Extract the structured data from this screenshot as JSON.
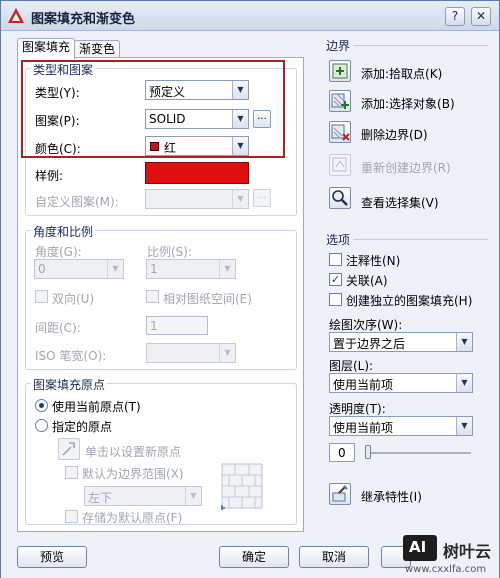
{
  "window": {
    "title": "图案填充和渐变色",
    "help_label": "?",
    "close_label": "✕"
  },
  "tabs": [
    {
      "label": "图案填充"
    },
    {
      "label": "渐变色"
    }
  ],
  "type_group": {
    "title": "类型和图案",
    "type_label": "类型(Y):",
    "type_value": "预定义",
    "pattern_label": "图案(P):",
    "pattern_value": "SOLID",
    "pattern_button": "...",
    "color_label": "颜色(C):",
    "color_value": "红",
    "color_hex": "#e01010",
    "sample_label": "样例:",
    "custom_label": "自定义图案(M):",
    "custom_button": "..."
  },
  "angle_group": {
    "title": "角度和比例",
    "angle_label": "角度(G):",
    "angle_value": "0",
    "scale_label": "比例(S):",
    "scale_value": "1",
    "double_label": "双向(U)",
    "relative_label": "相对图纸空间(E)",
    "spacing_label": "间距(C):",
    "spacing_value": "1",
    "iso_label": "ISO 笔宽(O):",
    "iso_value": ""
  },
  "origin_group": {
    "title": "图案填充原点",
    "current_label": "使用当前原点(T)",
    "specified_label": "指定的原点",
    "click_set_label": "单击以设置新原点",
    "default_boundary_label": "默认为边界范围(X)",
    "position_value": "左下",
    "store_default_label": "存储为默认原点(F)"
  },
  "boundary": {
    "title": "边界",
    "add_pick_label": "添加:拾取点(K)",
    "add_select_label": "添加:选择对象(B)",
    "remove_label": "删除边界(D)",
    "recreate_label": "重新创建边界(R)",
    "view_label": "查看选择集(V)"
  },
  "options": {
    "title": "选项",
    "annotative_label": "注释性(N)",
    "annotative_checked": false,
    "associative_label": "关联(A)",
    "associative_checked": true,
    "independent_label": "创建独立的图案填充(H)",
    "independent_checked": false,
    "draw_order_label": "绘图次序(W):",
    "draw_order_value": "置于边界之后",
    "layer_label": "图层(L):",
    "layer_value": "使用当前项",
    "transparency_label": "透明度(T):",
    "transparency_value": "使用当前项",
    "transparency_number": "0",
    "inherit_label": "继承特性(I)"
  },
  "buttons": {
    "preview": "预览",
    "ok": "确定",
    "cancel": "取消"
  },
  "watermark": {
    "brand": "AI",
    "site": "树叶云",
    "url": "www.cxxlfa.com"
  },
  "colors": {
    "accent_red": "#b51e1e",
    "sample_fill": "#e01010",
    "window_border": "#5d7ba8"
  }
}
